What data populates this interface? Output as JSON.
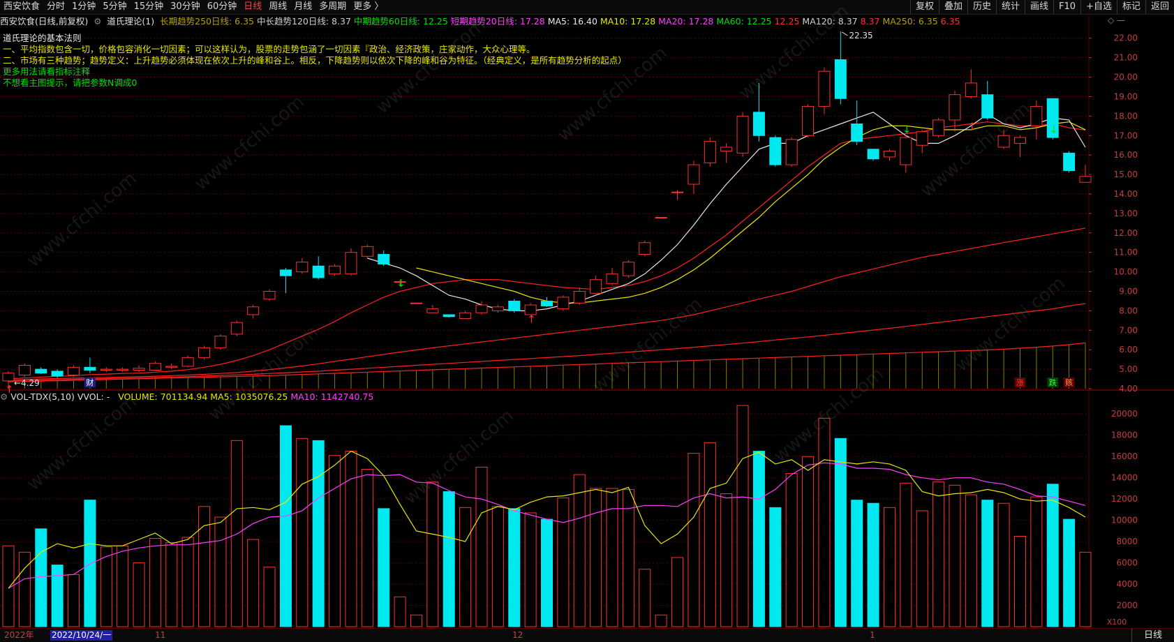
{
  "toolbar": {
    "stock": "西安饮食",
    "periods": [
      "分时",
      "1分钟",
      "5分钟",
      "15分钟",
      "30分钟",
      "60分钟",
      "日线",
      "周线",
      "月线",
      "多周期",
      "更多 〉"
    ],
    "active_period": "日线",
    "right_buttons": [
      "复权",
      "叠加",
      "历史",
      "统计",
      "画线",
      "F10",
      "+自选",
      "标记",
      "返回"
    ]
  },
  "info": {
    "title": "西安饮食(日线,前复权)",
    "indicator": "道氏理论(1)",
    "items": [
      {
        "text": "长期趋势250日线: 6.35",
        "color": "#b8a000"
      },
      {
        "text": "中长趋势120日线: 8.37",
        "color": "#d0d0d0"
      },
      {
        "text": "中期趋势60日线: 12.25",
        "color": "#00e000"
      },
      {
        "text": "短期趋势20日线: 17.28",
        "color": "#ff40ff"
      },
      {
        "text": "MA5: 16.40",
        "color": "#e8e8e8"
      },
      {
        "text": "MA10: 17.28",
        "color": "#e8e800"
      },
      {
        "text": "MA20: 17.28",
        "color": "#ff40ff"
      },
      {
        "text": "MA60: 12.25",
        "color": "#00e000"
      },
      {
        "text": "12.25",
        "color": "#ff3030"
      },
      {
        "text": "MA120: 8.37",
        "color": "#d0d0d0"
      },
      {
        "text": "8.37",
        "color": "#ff3030"
      },
      {
        "text": "MA250: 6.35",
        "color": "#b8a000"
      },
      {
        "text": "6.35",
        "color": "#ff3030"
      }
    ]
  },
  "legend": [
    "道氏理论的基本法则",
    "一、平均指数包含一切，价格包容消化一切因素；可以这样认为，股票的走势包涵了一切因素『政治、经济政策，庄家动作，大众心理等。",
    "二、市场有三种趋势；趋势定义：上升趋势必须体现在依次上升的峰和谷上。相反，下降趋势则以依次下降的峰和谷为特征。（经典定义，是所有趋势分析的起点）",
    "更多用法请看指标注释",
    "不想看主图提示，请把参数N调成0"
  ],
  "price_labels": {
    "high": "22.35",
    "low": "4.29"
  },
  "markers": {
    "cai": "财",
    "zhang": "涨",
    "die": "跌",
    "gai": "赅"
  },
  "price_axis": [
    "22.00",
    "21.00",
    "20.00",
    "19.00",
    "18.00",
    "17.00",
    "16.00",
    "15.00",
    "14.00",
    "13.00",
    "12.00",
    "11.00",
    "10.00",
    "9.00",
    "8.00",
    "7.00",
    "6.00",
    "5.00",
    "4.00"
  ],
  "vol": {
    "name": "VOL-TDX(5,10)",
    "vvol": "VVOL: -",
    "volume": "VOLUME: 701134.94",
    "ma5": "MA5: 1035076.25",
    "ma10": "MA10: 1142740.75"
  },
  "vol_axis": [
    "20000",
    "18000",
    "16000",
    "14000",
    "12000",
    "10000",
    "8000",
    "6000",
    "4000",
    "2000"
  ],
  "vol_unit": "X100",
  "bottom": {
    "year": "2022年",
    "date_sel": "2022/10/24/一",
    "m11": "11",
    "m12": "12",
    "m1": "1",
    "tab": "日线"
  },
  "watermark": "www.cfchi.com",
  "colors": {
    "up": "#ff3030",
    "down": "#00e8f0",
    "ma5": "#e8e8e8",
    "ma10": "#e8e800",
    "ma20": "#ff40ff",
    "grid": "#5a0000"
  },
  "chart_data": {
    "type": "candlestick",
    "price_range": [
      4.0,
      22.6
    ],
    "candles": [
      {
        "o": 4.4,
        "h": 4.9,
        "l": 4.29,
        "c": 4.8
      },
      {
        "o": 4.7,
        "h": 5.3,
        "l": 4.6,
        "c": 5.2
      },
      {
        "o": 5.0,
        "h": 5.1,
        "l": 4.75,
        "c": 4.8
      },
      {
        "o": 4.9,
        "h": 5.0,
        "l": 4.55,
        "c": 4.65
      },
      {
        "o": 4.7,
        "h": 5.2,
        "l": 4.6,
        "c": 5.1
      },
      {
        "o": 5.1,
        "h": 5.6,
        "l": 4.8,
        "c": 4.95
      },
      {
        "o": 4.95,
        "h": 5.1,
        "l": 4.85,
        "c": 5.0
      },
      {
        "o": 4.95,
        "h": 5.1,
        "l": 4.85,
        "c": 5.0
      },
      {
        "o": 4.95,
        "h": 5.2,
        "l": 4.85,
        "c": 5.05
      },
      {
        "o": 4.95,
        "h": 5.4,
        "l": 4.9,
        "c": 5.3
      },
      {
        "o": 5.1,
        "h": 5.3,
        "l": 5.0,
        "c": 5.15
      },
      {
        "o": 5.15,
        "h": 5.7,
        "l": 5.1,
        "c": 5.6
      },
      {
        "o": 5.6,
        "h": 6.2,
        "l": 5.5,
        "c": 6.1
      },
      {
        "o": 6.1,
        "h": 6.8,
        "l": 6.0,
        "c": 6.7
      },
      {
        "o": 6.8,
        "h": 7.5,
        "l": 6.7,
        "c": 7.4
      },
      {
        "o": 7.8,
        "h": 8.3,
        "l": 7.6,
        "c": 8.2
      },
      {
        "o": 8.6,
        "h": 9.1,
        "l": 8.5,
        "c": 9.0
      },
      {
        "o": 10.1,
        "h": 10.2,
        "l": 8.9,
        "c": 9.8
      },
      {
        "o": 10.0,
        "h": 10.7,
        "l": 9.9,
        "c": 10.5
      },
      {
        "o": 10.3,
        "h": 10.8,
        "l": 9.6,
        "c": 9.7
      },
      {
        "o": 9.9,
        "h": 10.4,
        "l": 9.8,
        "c": 10.3
      },
      {
        "o": 9.9,
        "h": 11.2,
        "l": 9.8,
        "c": 11.0
      },
      {
        "o": 10.8,
        "h": 11.4,
        "l": 10.7,
        "c": 11.3
      },
      {
        "o": 10.9,
        "h": 11.1,
        "l": 10.3,
        "c": 10.4
      },
      {
        "o": 9.5,
        "h": 9.6,
        "l": 9.3,
        "c": 9.5
      },
      {
        "o": 8.4,
        "h": 8.4,
        "l": 8.4,
        "c": 8.4
      },
      {
        "o": 7.9,
        "h": 8.3,
        "l": 7.9,
        "c": 8.1
      },
      {
        "o": 7.8,
        "h": 7.8,
        "l": 7.65,
        "c": 7.7
      },
      {
        "o": 7.6,
        "h": 8.0,
        "l": 7.6,
        "c": 7.9
      },
      {
        "o": 7.9,
        "h": 8.5,
        "l": 7.8,
        "c": 8.3
      },
      {
        "o": 8.0,
        "h": 8.3,
        "l": 7.9,
        "c": 8.2
      },
      {
        "o": 8.5,
        "h": 8.6,
        "l": 7.9,
        "c": 8.0
      },
      {
        "o": 7.8,
        "h": 8.4,
        "l": 7.8,
        "c": 8.3
      },
      {
        "o": 8.5,
        "h": 8.7,
        "l": 8.2,
        "c": 8.25
      },
      {
        "o": 8.1,
        "h": 8.8,
        "l": 8.0,
        "c": 8.7
      },
      {
        "o": 8.4,
        "h": 9.2,
        "l": 8.3,
        "c": 9.0
      },
      {
        "o": 8.9,
        "h": 9.8,
        "l": 8.8,
        "c": 9.6
      },
      {
        "o": 9.4,
        "h": 10.2,
        "l": 9.3,
        "c": 9.9
      },
      {
        "o": 9.8,
        "h": 10.6,
        "l": 9.7,
        "c": 10.5
      },
      {
        "o": 10.9,
        "h": 11.6,
        "l": 10.8,
        "c": 11.5
      },
      {
        "o": 12.8,
        "h": 12.8,
        "l": 12.8,
        "c": 12.8
      },
      {
        "o": 14.1,
        "h": 14.2,
        "l": 13.7,
        "c": 14.1
      },
      {
        "o": 14.5,
        "h": 15.7,
        "l": 14.0,
        "c": 15.5
      },
      {
        "o": 15.6,
        "h": 16.9,
        "l": 15.4,
        "c": 16.7
      },
      {
        "o": 16.2,
        "h": 16.6,
        "l": 15.6,
        "c": 16.4
      },
      {
        "o": 16.1,
        "h": 18.2,
        "l": 15.9,
        "c": 18.0
      },
      {
        "o": 18.2,
        "h": 19.7,
        "l": 16.7,
        "c": 17.0
      },
      {
        "o": 16.9,
        "h": 17.0,
        "l": 15.4,
        "c": 15.5
      },
      {
        "o": 15.5,
        "h": 16.9,
        "l": 15.4,
        "c": 16.8
      },
      {
        "o": 17.0,
        "h": 18.6,
        "l": 16.9,
        "c": 18.5
      },
      {
        "o": 18.5,
        "h": 20.5,
        "l": 18.1,
        "c": 20.3
      },
      {
        "o": 20.9,
        "h": 22.35,
        "l": 18.6,
        "c": 18.9
      },
      {
        "o": 17.6,
        "h": 18.8,
        "l": 16.5,
        "c": 16.7
      },
      {
        "o": 16.3,
        "h": 16.3,
        "l": 15.7,
        "c": 15.8
      },
      {
        "o": 15.9,
        "h": 16.3,
        "l": 15.7,
        "c": 16.2
      },
      {
        "o": 15.5,
        "h": 17.0,
        "l": 15.1,
        "c": 16.9
      },
      {
        "o": 16.5,
        "h": 17.3,
        "l": 16.1,
        "c": 17.2
      },
      {
        "o": 17.0,
        "h": 17.9,
        "l": 16.9,
        "c": 17.8
      },
      {
        "o": 17.8,
        "h": 19.3,
        "l": 17.2,
        "c": 19.1
      },
      {
        "o": 19.0,
        "h": 20.4,
        "l": 18.9,
        "c": 19.7
      },
      {
        "o": 19.1,
        "h": 19.8,
        "l": 17.8,
        "c": 17.9
      },
      {
        "o": 16.4,
        "h": 17.3,
        "l": 16.3,
        "c": 17.0
      },
      {
        "o": 16.6,
        "h": 17.0,
        "l": 15.9,
        "c": 16.9
      },
      {
        "o": 17.5,
        "h": 18.8,
        "l": 16.8,
        "c": 18.5
      },
      {
        "o": 18.9,
        "h": 18.9,
        "l": 16.8,
        "c": 16.9
      },
      {
        "o": 16.1,
        "h": 16.2,
        "l": 15.1,
        "c": 15.2
      },
      {
        "o": 14.6,
        "h": 15.5,
        "l": 14.6,
        "c": 14.9
      }
    ],
    "volume_range": [
      0,
      21000
    ],
    "volumes": [
      7600,
      7000,
      9200,
      5800,
      4900,
      11900,
      7500,
      7600,
      6000,
      8300,
      7900,
      8400,
      11300,
      10300,
      17500,
      8200,
      5600,
      18900,
      17700,
      17500,
      16100,
      16500,
      14800,
      11100,
      2800,
      1100,
      13600,
      12700,
      11200,
      15000,
      11300,
      11100,
      10700,
      10100,
      12100,
      14300,
      13000,
      13000,
      12900,
      5400,
      1100,
      6500,
      16300,
      17300,
      12500,
      20800,
      16500,
      11200,
      14400,
      16000,
      19600,
      17700,
      11900,
      11600,
      11200,
      13500,
      10900,
      13600,
      13300,
      12400,
      11900,
      11600,
      8500,
      12200,
      13400,
      10100,
      7000
    ],
    "vol_ma5": [
      3600,
      5500,
      7000,
      7800,
      7400,
      7800,
      7600,
      7600,
      8200,
      8800,
      7800,
      8200,
      9500,
      9800,
      11100,
      11200,
      11000,
      11700,
      13400,
      14100,
      15200,
      16500,
      15800,
      14200,
      11500,
      9000,
      8700,
      8400,
      8000,
      10700,
      11300,
      11000,
      11700,
      12200,
      12300,
      12600,
      12900,
      12600,
      13100,
      9500,
      7800,
      8700,
      10300,
      13000,
      13500,
      15800,
      16400,
      15300,
      15700,
      14700,
      15700,
      15500,
      15300,
      15500,
      15300,
      14700,
      12700,
      12300,
      12500,
      12600,
      12900,
      12600,
      12000,
      11800,
      11900,
      11200,
      10300
    ],
    "vol_ma10": [
      3600,
      4500,
      4700,
      4800,
      4900,
      5900,
      6600,
      7100,
      7400,
      7600,
      7700,
      7700,
      7900,
      8100,
      8700,
      9700,
      10300,
      10400,
      10900,
      12100,
      13000,
      13900,
      14300,
      14200,
      14300,
      13600,
      13500,
      12800,
      12200,
      12000,
      11500,
      10900,
      10500,
      10100,
      9800,
      10200,
      10700,
      11100,
      11100,
      11400,
      11400,
      11300,
      12100,
      12500,
      12100,
      12200,
      12000,
      12900,
      14300,
      15200,
      15400,
      15300,
      14900,
      14900,
      14800,
      14300,
      14000,
      13800,
      14000,
      14000,
      13600,
      13400,
      12900,
      12300,
      12200,
      11800,
      11400
    ],
    "ma5": [
      null,
      null,
      null,
      null,
      null,
      null,
      null,
      null,
      null,
      null,
      null,
      null,
      null,
      null,
      null,
      null,
      null,
      null,
      null,
      null,
      null,
      null,
      10.7,
      null,
      10.2,
      9.8,
      9.3,
      8.8,
      8.6,
      8.3,
      8.1,
      8.0,
      8.0,
      8.1,
      8.3,
      8.5,
      8.8,
      9.1,
      9.4,
      9.9,
      10.6,
      11.4,
      12.4,
      13.5,
      14.5,
      15.4,
      16.3,
      16.6,
      16.6,
      17.0,
      17.3,
      17.6,
      17.9,
      18.2,
      17.6,
      17.0,
      16.6,
      16.6,
      17.0,
      17.5,
      18.1,
      17.6,
      17.4,
      17.6,
      17.9,
      17.8,
      16.4
    ],
    "ma10": [
      null,
      null,
      null,
      null,
      null,
      null,
      null,
      null,
      null,
      null,
      null,
      null,
      null,
      null,
      null,
      null,
      null,
      null,
      null,
      null,
      null,
      null,
      null,
      null,
      null,
      10.2,
      10.0,
      9.8,
      9.6,
      9.4,
      9.2,
      9.0,
      8.7,
      8.5,
      8.4,
      8.4,
      8.5,
      8.6,
      8.7,
      8.9,
      9.2,
      9.6,
      10.1,
      10.7,
      11.4,
      12.1,
      12.8,
      13.6,
      14.3,
      15.0,
      15.8,
      16.4,
      16.9,
      17.3,
      17.5,
      17.5,
      17.4,
      17.3,
      17.3,
      17.3,
      17.5,
      17.5,
      17.3,
      17.4,
      17.6,
      17.7,
      17.3
    ],
    "ma20": [
      4.5,
      4.55,
      4.6,
      4.63,
      4.67,
      4.72,
      4.75,
      4.78,
      4.8,
      4.85,
      4.9,
      4.98,
      5.1,
      5.25,
      5.45,
      5.7,
      6.0,
      6.35,
      6.7,
      7.05,
      7.45,
      7.9,
      8.3,
      8.7,
      9.0,
      9.2,
      9.4,
      9.5,
      9.6,
      9.6,
      9.6,
      9.5,
      9.4,
      9.3,
      9.2,
      9.15,
      9.1,
      9.2,
      9.3,
      9.5,
      9.8,
      10.2,
      10.7,
      11.3,
      11.9,
      12.6,
      13.3,
      14.0,
      14.7,
      15.4,
      16.0,
      16.6,
      16.8,
      16.9,
      17.0,
      17.1,
      17.2,
      17.4,
      17.5,
      17.6,
      17.7,
      17.6,
      17.5,
      17.5,
      17.6,
      17.4,
      17.28
    ],
    "ma60": [
      4.45,
      4.47,
      4.5,
      4.52,
      4.54,
      4.56,
      4.58,
      4.6,
      4.62,
      4.64,
      4.67,
      4.7,
      4.74,
      4.78,
      4.83,
      4.9,
      4.98,
      5.07,
      5.17,
      5.28,
      5.4,
      5.52,
      5.64,
      5.76,
      5.88,
      5.99,
      6.1,
      6.2,
      6.3,
      6.4,
      6.5,
      6.6,
      6.7,
      6.8,
      6.9,
      7.0,
      7.1,
      7.2,
      7.3,
      7.4,
      7.5,
      7.65,
      7.8,
      8.0,
      8.2,
      8.4,
      8.6,
      8.8,
      9.0,
      9.25,
      9.5,
      9.75,
      9.95,
      10.15,
      10.35,
      10.55,
      10.75,
      10.9,
      11.05,
      11.2,
      11.35,
      11.5,
      11.65,
      11.8,
      11.95,
      12.1,
      12.25
    ],
    "ma120": [
      4.4,
      4.42,
      4.44,
      4.46,
      4.48,
      4.5,
      4.52,
      4.54,
      4.56,
      4.58,
      4.6,
      4.62,
      4.65,
      4.68,
      4.71,
      4.74,
      4.78,
      4.82,
      4.86,
      4.9,
      4.95,
      5.0,
      5.05,
      5.1,
      5.15,
      5.2,
      5.25,
      5.3,
      5.35,
      5.4,
      5.45,
      5.5,
      5.55,
      5.6,
      5.65,
      5.7,
      5.76,
      5.82,
      5.88,
      5.94,
      6.0,
      6.06,
      6.13,
      6.2,
      6.27,
      6.34,
      6.42,
      6.5,
      6.58,
      6.66,
      6.74,
      6.83,
      6.92,
      7.01,
      7.1,
      7.2,
      7.3,
      7.4,
      7.5,
      7.6,
      7.7,
      7.8,
      7.9,
      8.0,
      8.1,
      8.25,
      8.37
    ],
    "ma250": [
      4.35,
      4.37,
      4.39,
      4.41,
      4.43,
      4.45,
      4.47,
      4.49,
      4.51,
      4.53,
      4.55,
      4.57,
      4.59,
      4.61,
      4.63,
      4.65,
      4.67,
      4.7,
      4.73,
      4.76,
      4.79,
      4.82,
      4.85,
      4.88,
      4.91,
      4.94,
      4.97,
      5.0,
      5.03,
      5.06,
      5.09,
      5.12,
      5.15,
      5.18,
      5.21,
      5.24,
      5.27,
      5.3,
      5.33,
      5.36,
      5.39,
      5.42,
      5.45,
      5.48,
      5.51,
      5.54,
      5.57,
      5.6,
      5.63,
      5.66,
      5.69,
      5.72,
      5.75,
      5.78,
      5.81,
      5.84,
      5.87,
      5.9,
      5.93,
      5.96,
      5.99,
      6.03,
      6.08,
      6.13,
      6.19,
      6.26,
      6.35
    ]
  }
}
